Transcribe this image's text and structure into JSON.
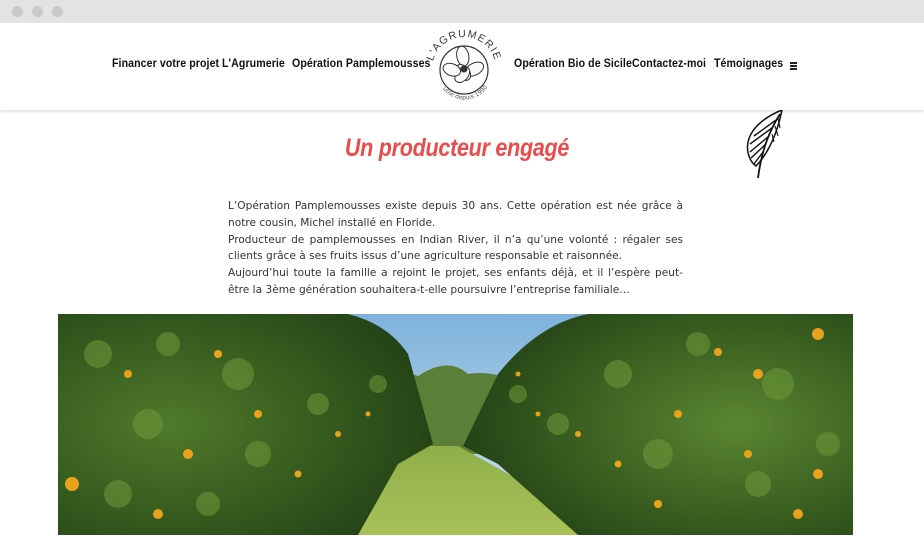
{
  "nav": {
    "left": [
      "Financer votre projet",
      "L'Agrumerie",
      "Opération Pamplemousses"
    ],
    "right": [
      "Opération Bio de Sicile",
      "Contactez-moi",
      "Témoignages"
    ]
  },
  "logo": {
    "name": "L'AGRUMERIE",
    "tagline": "utile depuis 1990"
  },
  "icons": {
    "menu": "hamburger-menu-icon",
    "feather": "feather-icon",
    "window_dots": "window-control-dots"
  },
  "main": {
    "heading": "Un producteur engagé",
    "paragraphs": [
      "L’Opération Pamplemousses existe depuis 30 ans. Cette opération est née grâce à notre cousin, Michel installé en Floride.",
      "Producteur de pamplemousses en Indian River, il n’a qu’une volonté : régaler ses clients grâce à ses fruits issus d’une agriculture responsable et raisonnée.",
      "Aujourd’hui toute la famille a rejoint le projet, ses enfants déjà, et il l’espère peut-être la 3ème génération souhaitera-t-elle poursuivre l’entreprise familiale…"
    ]
  },
  "colors": {
    "accent": "#ec4b4b",
    "text": "#333333",
    "nav_text": "#111111",
    "chrome": "#e3e3e3"
  }
}
